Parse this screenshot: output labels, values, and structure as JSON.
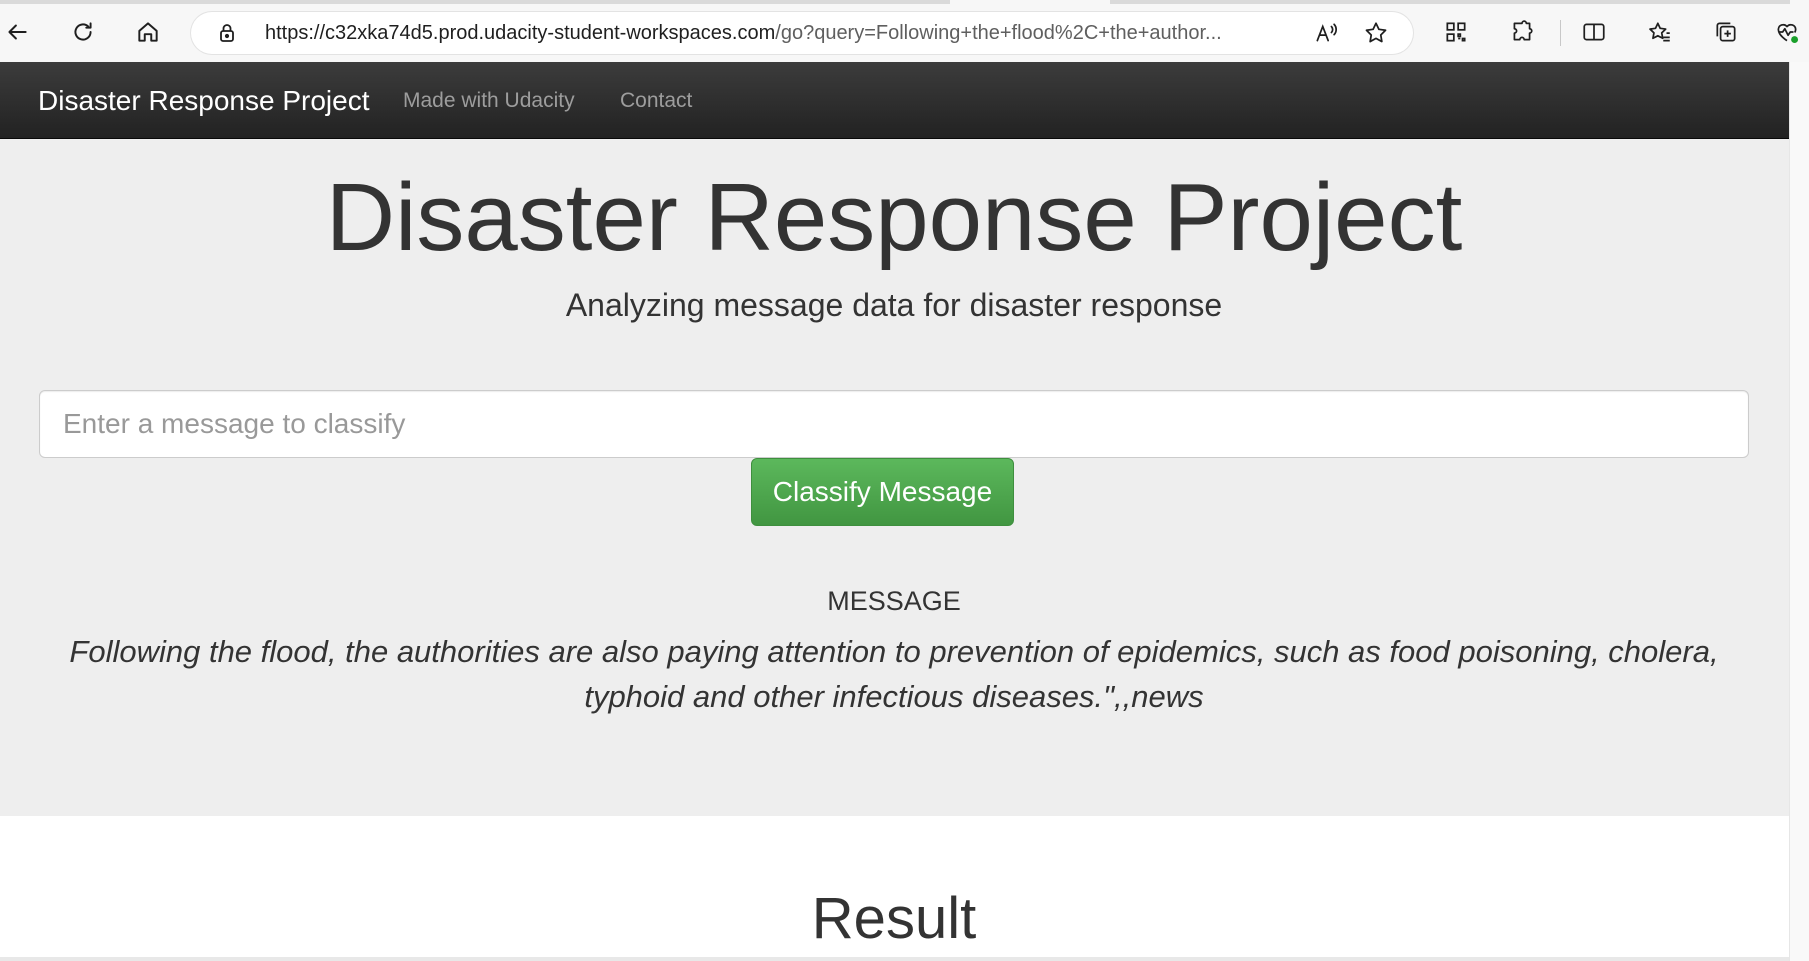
{
  "browser": {
    "url_host": "https://c32xka74d5.prod.udacity-student-workspaces.com",
    "url_rest": "/go?query=Following+the+flood%2C+the+author...",
    "icons": {
      "back": "back-arrow-icon",
      "refresh": "refresh-icon",
      "home": "home-icon",
      "lock": "lock-icon",
      "read_aloud": "read-aloud-icon",
      "favorite": "star-icon",
      "qr": "qr-code-icon",
      "extensions": "puzzle-icon",
      "split_screen": "split-screen-icon",
      "favorites": "favorites-icon",
      "collections": "collections-icon",
      "health": "browser-essentials-icon"
    }
  },
  "navbar": {
    "brand": "Disaster Response Project",
    "links": [
      "Made with Udacity",
      "Contact"
    ]
  },
  "hero": {
    "title": "Disaster Response Project",
    "subtitle": "Analyzing message data for disaster response"
  },
  "form": {
    "input_placeholder": "Enter a message to classify",
    "input_value": "",
    "button_label": "Classify Message"
  },
  "message": {
    "heading": "MESSAGE",
    "text": "Following the flood, the authorities are also paying attention to prevention of epidemics, such as food poisoning, cholera, typhoid and other infectious diseases.\",,news"
  },
  "result": {
    "title": "Result"
  },
  "colors": {
    "navbar": "#222222",
    "jumbotron": "#eeeeee",
    "button": "#5cb85c",
    "text": "#333333"
  }
}
